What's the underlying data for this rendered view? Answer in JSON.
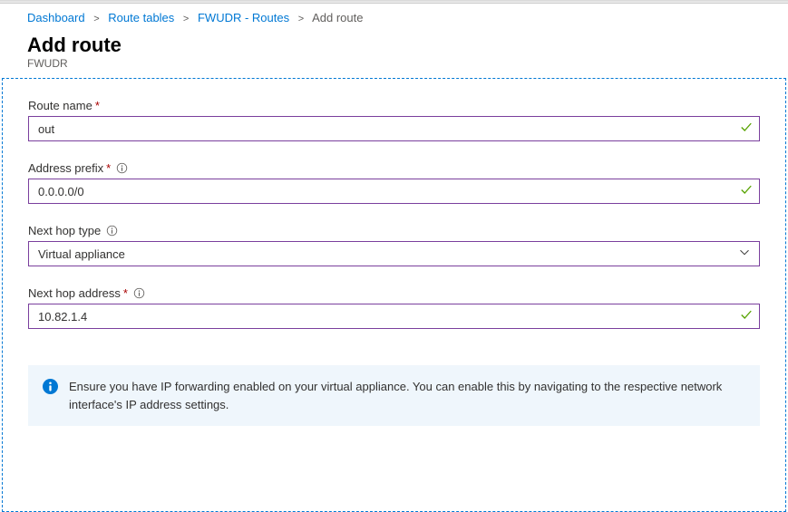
{
  "breadcrumb": {
    "items": [
      {
        "label": "Dashboard",
        "link": true
      },
      {
        "label": "Route tables",
        "link": true
      },
      {
        "label": "FWUDR - Routes",
        "link": true
      },
      {
        "label": "Add route",
        "link": false
      }
    ]
  },
  "header": {
    "title": "Add route",
    "subtitle": "FWUDR"
  },
  "form": {
    "routeName": {
      "label": "Route name",
      "value": "out",
      "required": true,
      "valid": true
    },
    "addressPrefix": {
      "label": "Address prefix",
      "value": "0.0.0.0/0",
      "required": true,
      "hasInfo": true,
      "valid": true
    },
    "nextHopType": {
      "label": "Next hop type",
      "value": "Virtual appliance",
      "hasInfo": true
    },
    "nextHopAddress": {
      "label": "Next hop address",
      "value": "10.82.1.4",
      "required": true,
      "hasInfo": true,
      "valid": true
    }
  },
  "infoBox": {
    "text": "Ensure you have IP forwarding enabled on your virtual appliance. You can enable this by navigating to the respective network interface's IP address settings."
  }
}
